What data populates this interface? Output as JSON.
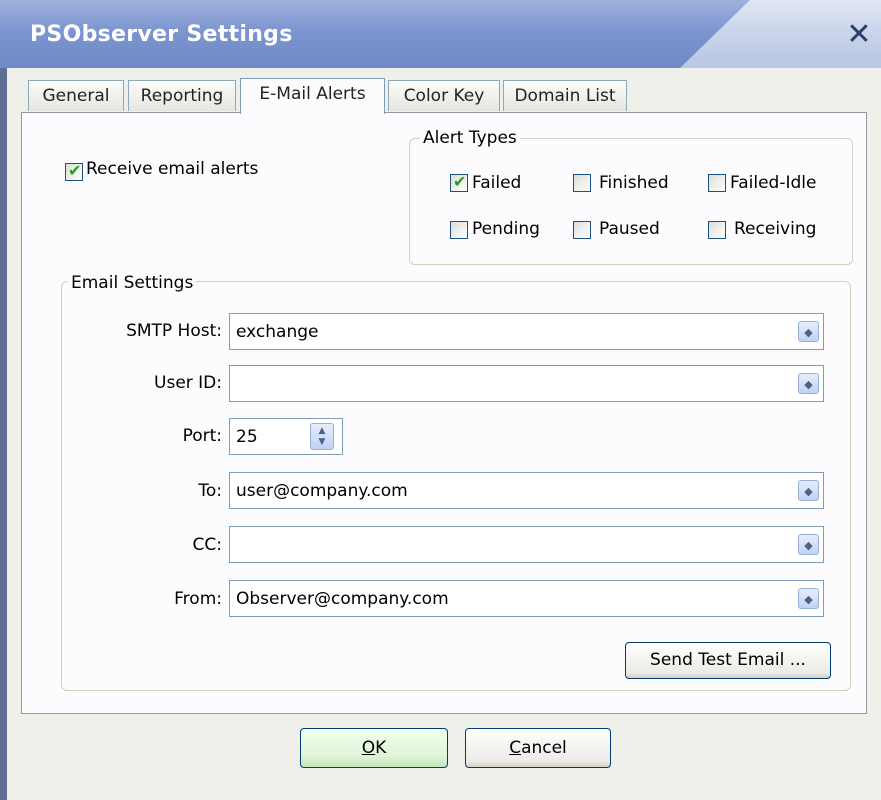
{
  "window": {
    "title": "PSObserver Settings",
    "close_glyph": "✕"
  },
  "tabs": [
    {
      "label": "General"
    },
    {
      "label": "Reporting"
    },
    {
      "label": "E-Mail Alerts",
      "active": true
    },
    {
      "label": "Color Key"
    },
    {
      "label": "Domain List"
    }
  ],
  "receive_alerts": {
    "label": "Receive email alerts",
    "checked": true
  },
  "alert_types": {
    "title": "Alert Types",
    "items": [
      {
        "label": "Failed",
        "checked": true
      },
      {
        "label": "Finished",
        "checked": false
      },
      {
        "label": "Failed-Idle",
        "checked": false
      },
      {
        "label": "Pending",
        "checked": false
      },
      {
        "label": "Paused",
        "checked": false
      },
      {
        "label": "Receiving",
        "checked": false
      }
    ]
  },
  "email_settings": {
    "title": "Email Settings",
    "smtp_host": {
      "label": "SMTP Host:",
      "value": "exchange"
    },
    "user_id": {
      "label": "User ID:",
      "value": ""
    },
    "port": {
      "label": "Port:",
      "value": "25"
    },
    "to": {
      "label": "To:",
      "value": "user@company.com"
    },
    "cc": {
      "label": "CC:",
      "value": ""
    },
    "from": {
      "label": "From:",
      "value": "Observer@company.com"
    },
    "send_test_label": "Send Test Email ..."
  },
  "buttons": {
    "ok": {
      "mnemonic": "O",
      "rest": "K"
    },
    "cancel": {
      "mnemonic": "C",
      "rest": "ancel"
    }
  },
  "icons": {
    "check": "✔",
    "dropdown": "◆",
    "spin_up": "▲",
    "spin_down": "▼"
  }
}
